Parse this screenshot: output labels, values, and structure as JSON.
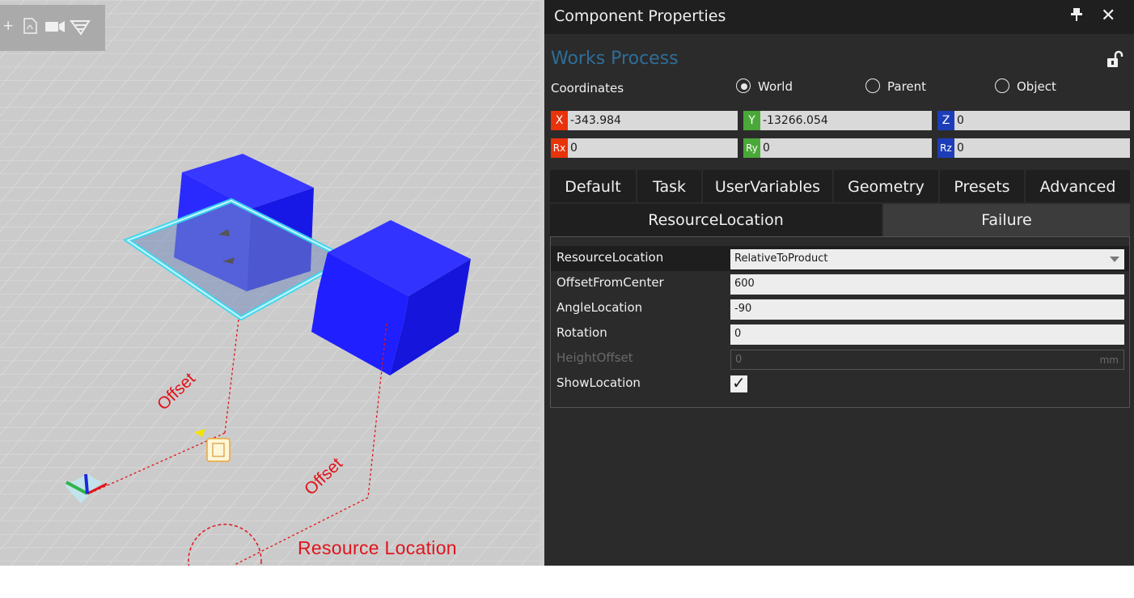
{
  "viewport": {
    "toolbar_icons": [
      "plus-icon",
      "pdf-icon",
      "video-camera-icon",
      "snapshot-icon"
    ],
    "annotations": {
      "offset_1": "Offset",
      "offset_2": "Offset",
      "resource_location": "Resource Location"
    },
    "colors": {
      "block": "#1a1aff",
      "highlight": "#36d8f0",
      "annotation": "#e0141c"
    }
  },
  "panel": {
    "title": "Component Properties",
    "component_name": "Works Process",
    "coordinates": {
      "label": "Coordinates",
      "modes": [
        {
          "label": "World",
          "selected": true
        },
        {
          "label": "Parent",
          "selected": false
        },
        {
          "label": "Object",
          "selected": false
        }
      ],
      "fields": [
        {
          "tag": "X",
          "value": "-343.984",
          "color": "#e8330b"
        },
        {
          "tag": "Y",
          "value": "-13266.054",
          "color": "#4aa838"
        },
        {
          "tag": "Z",
          "value": "0",
          "color": "#1d3db8"
        },
        {
          "tag": "Rx",
          "value": "0",
          "color": "#e8330b"
        },
        {
          "tag": "Ry",
          "value": "0",
          "color": "#4aa838"
        },
        {
          "tag": "Rz",
          "value": "0",
          "color": "#1d3db8"
        }
      ]
    },
    "tabs": [
      "Default",
      "Task",
      "UserVariables",
      "Geometry",
      "Presets",
      "Advanced"
    ],
    "subtabs": [
      {
        "label": "ResourceLocation",
        "active": true
      },
      {
        "label": "Failure",
        "active": false
      }
    ],
    "properties": [
      {
        "label": "ResourceLocation",
        "value": "RelativeToProduct",
        "kind": "dropdown"
      },
      {
        "label": "OffsetFromCenter",
        "value": "600",
        "kind": "text"
      },
      {
        "label": "AngleLocation",
        "value": "-90",
        "kind": "text"
      },
      {
        "label": "Rotation",
        "value": "0",
        "kind": "text"
      },
      {
        "label": "HeightOffset",
        "value": "0",
        "unit": "mm",
        "kind": "disabled"
      },
      {
        "label": "ShowLocation",
        "checked": true,
        "kind": "checkbox"
      }
    ]
  }
}
